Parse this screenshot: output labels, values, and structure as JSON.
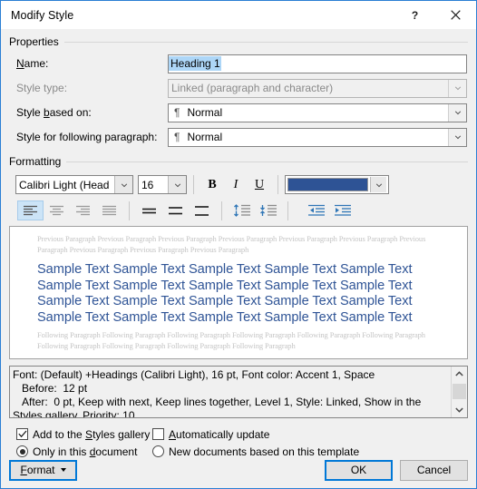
{
  "window": {
    "title": "Modify Style",
    "help_label": "?",
    "close_label": "✕"
  },
  "properties": {
    "group_label": "Properties",
    "name_label": "Name:",
    "name_value": "Heading 1",
    "style_type_label": "Style type:",
    "style_type_value": "Linked (paragraph and character)",
    "style_based_on_label": "Style based on:",
    "style_based_on_value": "Normal",
    "style_following_label": "Style for following paragraph:",
    "style_following_value": "Normal",
    "pilcrow": "¶"
  },
  "formatting": {
    "group_label": "Formatting",
    "font_name": "Calibri Light (Head",
    "font_size": "16",
    "bold_label": "B",
    "italic_label": "I",
    "underline_label": "U",
    "font_color": "#2e5395",
    "accent_selected": "#cce4f7",
    "icons": {
      "align_left": "align-left-icon",
      "align_center": "align-center-icon",
      "align_right": "align-right-icon",
      "align_justify": "align-justify-icon",
      "line_spacing_1": "line-spacing-single-icon",
      "line_spacing_15": "line-spacing-1-5-icon",
      "line_spacing_2": "line-spacing-double-icon",
      "space_before": "increase-paragraph-spacing-icon",
      "space_after": "decrease-paragraph-spacing-icon",
      "indent_decrease": "decrease-indent-icon",
      "indent_increase": "increase-indent-icon"
    }
  },
  "preview": {
    "previous_paragraph": "Previous Paragraph Previous Paragraph Previous Paragraph Previous Paragraph Previous Paragraph Previous Paragraph Previous Paragraph Previous Paragraph Previous Paragraph Previous Paragraph",
    "sample_text": "Sample Text Sample Text Sample Text Sample Text Sample Text Sample Text Sample Text Sample Text Sample Text Sample Text Sample Text Sample Text Sample Text Sample Text Sample Text Sample Text Sample Text Sample Text Sample Text Sample Text",
    "following_paragraph": "Following Paragraph Following Paragraph Following Paragraph Following Paragraph Following Paragraph Following Paragraph Following Paragraph Following Paragraph Following Paragraph Following Paragraph",
    "sample_color": "#2f5496"
  },
  "description": {
    "text": "Font: (Default) +Headings (Calibri Light), 16 pt, Font color: Accent 1, Space\n   Before:  12 pt\n   After:  0 pt, Keep with next, Keep lines together, Level 1, Style: Linked, Show in the Styles gallery, Priority: 10",
    "scroll_up": "⌃",
    "scroll_down": "⌄"
  },
  "options": {
    "add_to_gallery_label": "Add to the Styles gallery",
    "add_to_gallery_checked": true,
    "automatically_update_label": "Automatically update",
    "automatically_update_checked": false,
    "only_this_document_label": "Only in this document",
    "only_this_document_selected": true,
    "new_documents_label": "New documents based on this template",
    "new_documents_selected": false
  },
  "footer": {
    "format_label": "Format",
    "ok_label": "OK",
    "cancel_label": "Cancel"
  }
}
